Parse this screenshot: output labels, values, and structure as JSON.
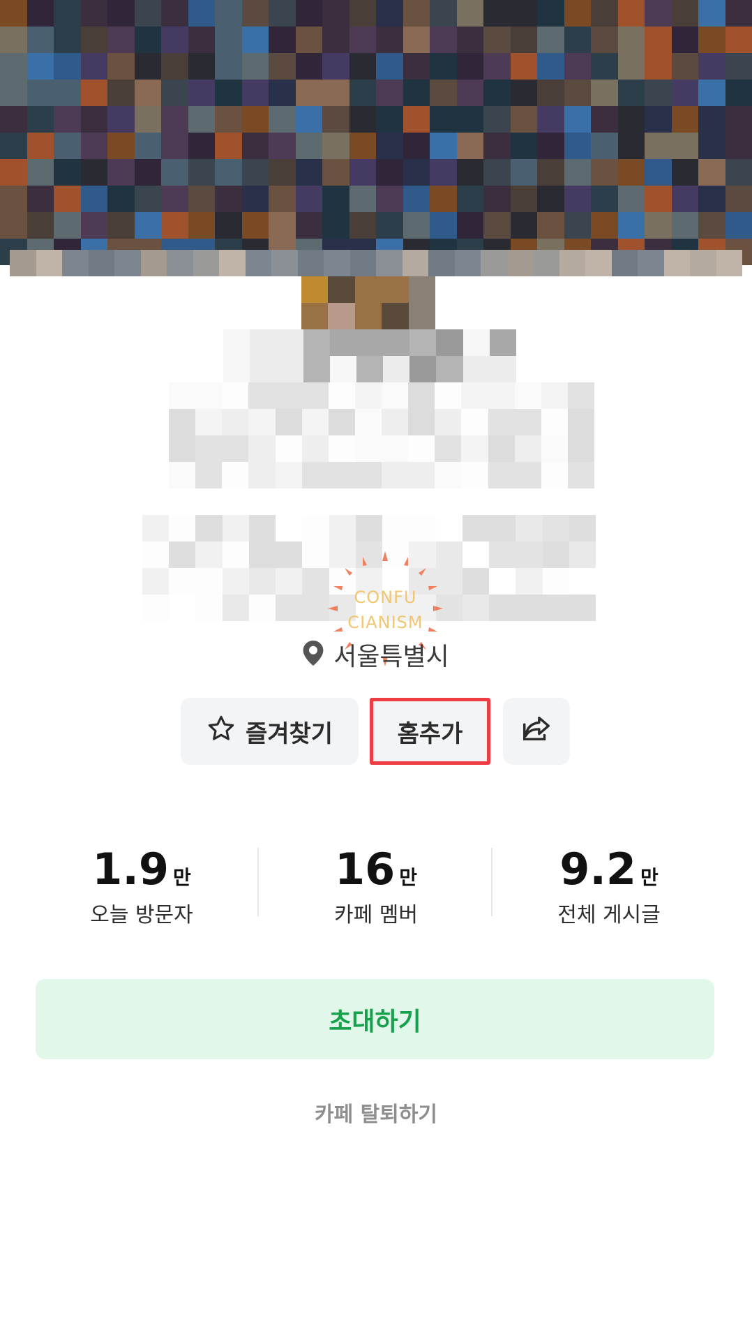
{
  "location": {
    "icon": "map-pin-icon",
    "text": "서울특별시"
  },
  "actions": {
    "favorite_label": "즐겨찾기",
    "favorite_icon": "star-icon",
    "home_add_label": "홈추가",
    "share_icon": "share-icon"
  },
  "stats": [
    {
      "value": "1.9",
      "unit": "만",
      "label": "오늘 방문자"
    },
    {
      "value": "16",
      "unit": "만",
      "label": "카페 멤버"
    },
    {
      "value": "9.2",
      "unit": "만",
      "label": "전체 게시글"
    }
  ],
  "invite_label": "초대하기",
  "leave_label": "카페 탈퇴하기",
  "watermark": {
    "line1": "CONFU",
    "line2": "CIANISM"
  },
  "colors": {
    "invite_bg": "#e1f7ea",
    "invite_text": "#17a14d",
    "highlight_border": "#ee3e44"
  }
}
